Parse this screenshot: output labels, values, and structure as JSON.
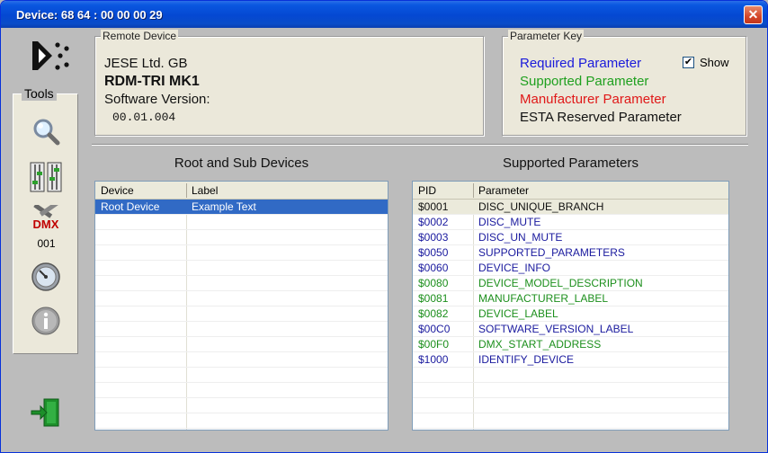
{
  "window": {
    "title": "Device:  68 64 : 00 00 00 29"
  },
  "icons": {
    "logo": "rdm-logo-icon",
    "tools": [
      "magnifier-icon",
      "sliders-icon",
      "dmx-tools-icon",
      "gauge-icon",
      "info-icon"
    ],
    "exit": "exit-door-icon",
    "close": "close-icon"
  },
  "tools": {
    "label": "Tools",
    "dmx_address": "001"
  },
  "remote_device": {
    "legend": "Remote Device",
    "manufacturer": "JESE Ltd. GB",
    "model": "RDM-TRI MK1",
    "software_label": "Software Version:",
    "software_version": "00.01.004"
  },
  "parameter_key": {
    "legend": "Parameter Key",
    "show_label": "Show",
    "show_checked": true,
    "keys": [
      {
        "label": "Required Parameter",
        "color": "#1a1adb"
      },
      {
        "label": "Supported Parameter",
        "color": "#1fa01f"
      },
      {
        "label": "Manufacturer Parameter",
        "color": "#e01818"
      },
      {
        "label": "ESTA Reserved Parameter",
        "color": "#111111"
      }
    ]
  },
  "devices": {
    "title": "Root and Sub Devices",
    "columns": [
      "Device",
      "Label"
    ],
    "rows": [
      {
        "device": "Root Device",
        "label": "Example Text",
        "selected": true
      }
    ]
  },
  "parameters": {
    "title": "Supported Parameters",
    "columns": [
      "PID",
      "Parameter"
    ],
    "rows": [
      {
        "pid": "$0001",
        "name": "DISC_UNIQUE_BRANCH",
        "type": "esta"
      },
      {
        "pid": "$0002",
        "name": "DISC_MUTE",
        "type": "required"
      },
      {
        "pid": "$0003",
        "name": "DISC_UN_MUTE",
        "type": "required"
      },
      {
        "pid": "$0050",
        "name": "SUPPORTED_PARAMETERS",
        "type": "required"
      },
      {
        "pid": "$0060",
        "name": "DEVICE_INFO",
        "type": "required"
      },
      {
        "pid": "$0080",
        "name": "DEVICE_MODEL_DESCRIPTION",
        "type": "supported"
      },
      {
        "pid": "$0081",
        "name": "MANUFACTURER_LABEL",
        "type": "supported"
      },
      {
        "pid": "$0082",
        "name": "DEVICE_LABEL",
        "type": "supported"
      },
      {
        "pid": "$00C0",
        "name": "SOFTWARE_VERSION_LABEL",
        "type": "required"
      },
      {
        "pid": "$00F0",
        "name": "DMX_START_ADDRESS",
        "type": "supported"
      },
      {
        "pid": "$1000",
        "name": "IDENTIFY_DEVICE",
        "type": "required"
      }
    ]
  },
  "type_colors": {
    "required": "#1a1a9e",
    "supported": "#1c8f1c",
    "esta": "#111111",
    "manufacturer": "#e01818"
  }
}
